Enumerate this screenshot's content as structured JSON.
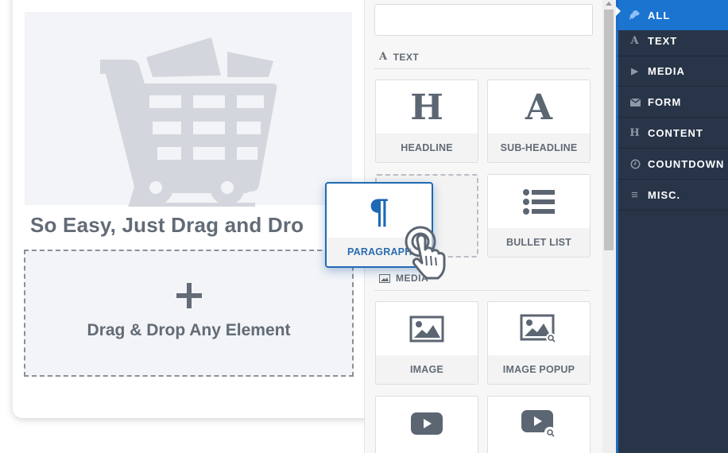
{
  "canvas": {
    "heading": "So Easy, Just Drag and Dro",
    "drop_zone": {
      "plus_icon": "plus-icon",
      "label": "Drag & Drop Any Element"
    },
    "image_icon": "shopping-cart-icon"
  },
  "panel": {
    "search": {
      "value": "",
      "placeholder": ""
    },
    "sections": [
      {
        "label": "TEXT",
        "icon": "serif-a-icon",
        "tiles": [
          {
            "label": "HEADLINE",
            "glyph": "H",
            "icon": "headline-icon"
          },
          {
            "label": "SUB-HEADLINE",
            "glyph": "A",
            "icon": "sub-headline-icon"
          },
          {
            "label": "",
            "icon": "empty-slot",
            "placeholder": true
          },
          {
            "label": "BULLET LIST",
            "icon": "bullet-list-icon"
          }
        ]
      },
      {
        "label": "MEDIA",
        "icon": "image-icon",
        "tiles": [
          {
            "label": "IMAGE",
            "icon": "image-icon"
          },
          {
            "label": "IMAGE POPUP",
            "icon": "image-popup-icon"
          },
          {
            "label": "",
            "icon": "video-icon"
          },
          {
            "label": "",
            "icon": "video-popup-icon"
          }
        ]
      }
    ]
  },
  "dragged_tile": {
    "label": "PARAGRAPH",
    "glyph": "¶",
    "icon": "paragraph-icon"
  },
  "sidebar": {
    "accent": "#1b74d0",
    "background": "#283548",
    "items": [
      {
        "label": "ALL",
        "icon": "plug-icon",
        "glyph": "",
        "active": true
      },
      {
        "label": "TEXT",
        "icon": "serif-a-icon",
        "glyph": "A",
        "active": false
      },
      {
        "label": "MEDIA",
        "icon": "play-icon",
        "glyph": "▶",
        "active": false
      },
      {
        "label": "FORM",
        "icon": "envelope-icon",
        "glyph": "",
        "active": false
      },
      {
        "label": "CONTENT",
        "icon": "serif-h-icon",
        "glyph": "H",
        "active": false
      },
      {
        "label": "COUNTDOWN",
        "icon": "clock-icon",
        "glyph": "",
        "active": false
      },
      {
        "label": "MISC.",
        "icon": "menu-lines-icon",
        "glyph": "≡",
        "active": false
      }
    ]
  }
}
